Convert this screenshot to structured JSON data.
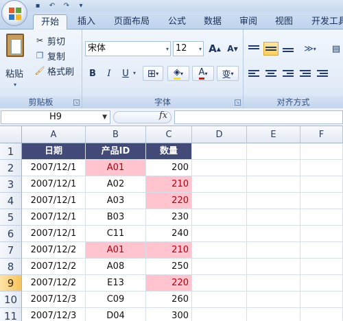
{
  "ribbon": {
    "tabs": [
      "开始",
      "插入",
      "页面布局",
      "公式",
      "数据",
      "审阅",
      "视图",
      "开发工具"
    ],
    "active_tab": "开始",
    "clipboard": {
      "paste_label": "粘贴",
      "cut_label": "剪切",
      "copy_label": "复制",
      "format_painter_label": "格式刷",
      "group_label": "剪贴板"
    },
    "font": {
      "font_name": "宋体",
      "font_size": "12",
      "bold": "B",
      "italic": "I",
      "underline": "U",
      "grow_font": "A",
      "shrink_font": "A",
      "font_color": "A",
      "phonetic": "变",
      "group_label": "字体"
    },
    "alignment": {
      "group_label": "对齐方式"
    }
  },
  "formula_bar": {
    "name_box": "H9",
    "fx": "fx"
  },
  "sheet": {
    "columns": [
      "A",
      "B",
      "C",
      "D",
      "E",
      "F"
    ],
    "rows": [
      "1",
      "2",
      "3",
      "4",
      "5",
      "6",
      "7",
      "8",
      "9",
      "10",
      "11"
    ],
    "active_row": "9",
    "headers": [
      "日期",
      "产品ID",
      "数量"
    ],
    "data": [
      [
        "2007/12/1",
        "A01",
        "200"
      ],
      [
        "2007/12/1",
        "A02",
        "210"
      ],
      [
        "2007/12/1",
        "A03",
        "220"
      ],
      [
        "2007/12/1",
        "B03",
        "230"
      ],
      [
        "2007/12/1",
        "C11",
        "240"
      ],
      [
        "2007/12/2",
        "A01",
        "210"
      ],
      [
        "2007/12/2",
        "A08",
        "250"
      ],
      [
        "2007/12/2",
        "E13",
        "220"
      ],
      [
        "2007/12/3",
        "C09",
        "260"
      ],
      [
        "2007/12/3",
        "D04",
        "300"
      ]
    ],
    "highlight_color": "#ffc4cd",
    "highlight_text_color": "#b20011",
    "header_fill": "#424a78"
  }
}
